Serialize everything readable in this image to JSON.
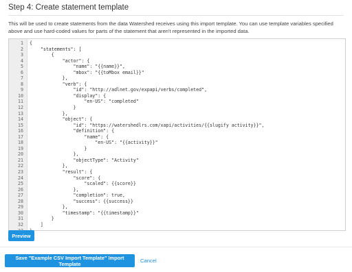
{
  "step": {
    "title": "Step 4: Create statement template",
    "description": "This will be used to create statements from the data Watershed receives using this import template. You can use template variables specified above and use hard-coded values for parts of the statement that aren't represented in the imported data."
  },
  "editor": {
    "lines": [
      "{",
      "    \"statements\": [",
      "        {",
      "            \"actor\": {",
      "                \"name\": \"{{name}}\",",
      "                \"mbox\": \"{{toMbox email}}\"",
      "            },",
      "            \"verb\": {",
      "                \"id\": \"http://adlnet.gov/expapi/verbs/completed\",",
      "                \"display\": {",
      "                    \"en-US\": \"completed\"",
      "                }",
      "            },",
      "            \"object\": {",
      "                \"id\": \"https://watershedlrs.com/xapi/activities/{{slugify activity}}\",",
      "                \"definition\": {",
      "                    \"name\": {",
      "                        \"en-US\": \"{{activity}}\"",
      "                    }",
      "                },",
      "                \"objectType\": \"Activity\"",
      "            },",
      "            \"result\": {",
      "                \"score\": {",
      "                    \"scaled\": {{score}}",
      "                },",
      "                \"completion\": true,",
      "                \"success\": {{success}}",
      "            },",
      "            \"timestamp\": \"{{timestamp}}\"",
      "        }",
      "    ]",
      "}"
    ]
  },
  "actions": {
    "preview_label": "Preview",
    "save_label": "Save \"Example CSV Import Template\" Import Template",
    "cancel_label": "Cancel"
  },
  "colors": {
    "accent": "#1f92e0",
    "link": "#1f8fdc",
    "gutter": "#eeeeee"
  }
}
